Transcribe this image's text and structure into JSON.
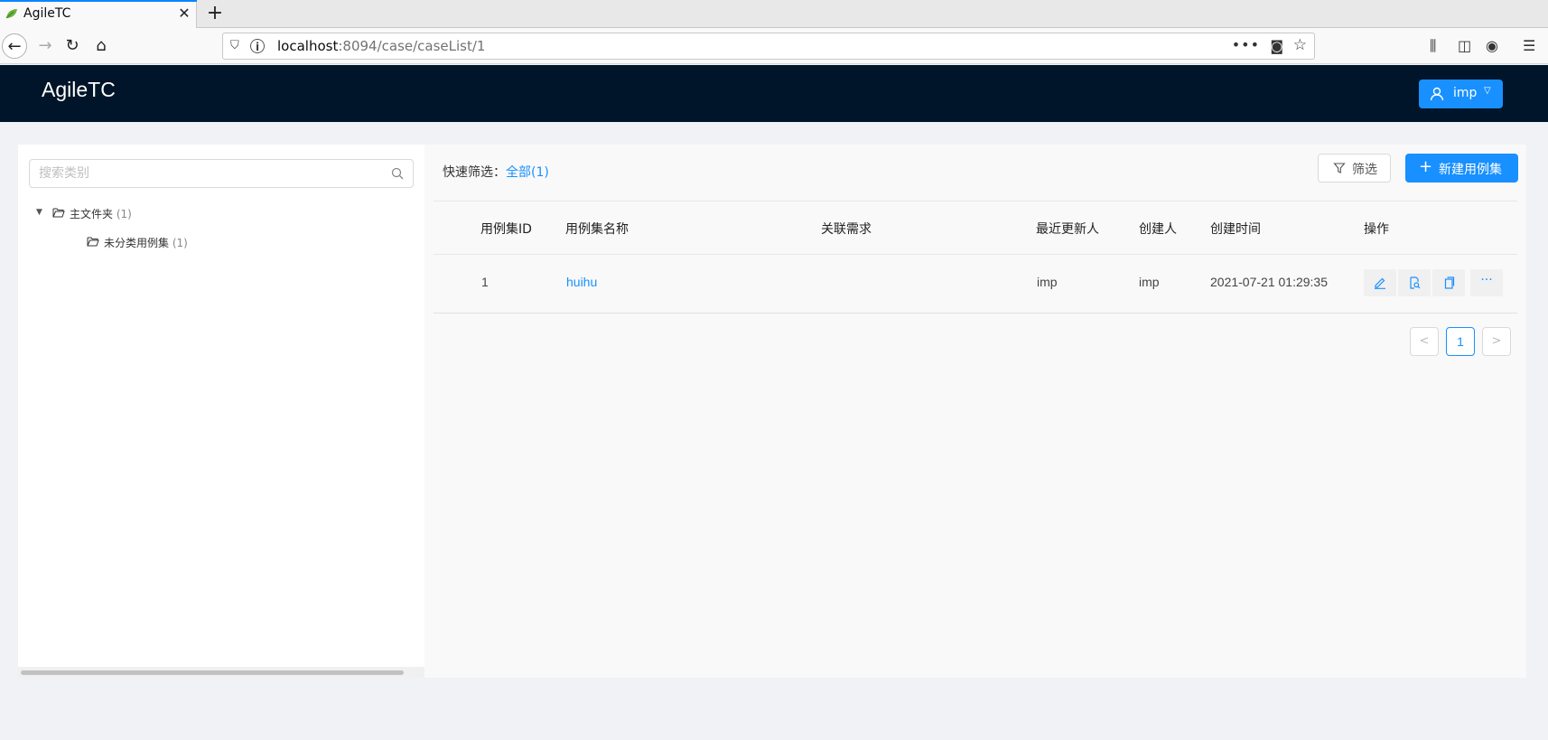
{
  "browser": {
    "tab_title": "AgileTC",
    "url_host": "localhost",
    "url_rest": ":8094/case/caseList/1",
    "icons": [
      "back-icon",
      "forward-icon",
      "reload-icon",
      "home-icon",
      "shield-icon",
      "info-icon",
      "more-icon",
      "pocket-icon",
      "star-icon",
      "library-icon",
      "sidebar-icon",
      "account-icon",
      "menu-icon"
    ]
  },
  "header": {
    "logo": "AgileTC",
    "user_name": "imp",
    "bg_color": "#001529",
    "accent_color": "#1890ff"
  },
  "sidebar": {
    "search_placeholder": "搜索类别",
    "tree": [
      {
        "label": "主文件夹",
        "count": "(1)"
      },
      {
        "label": "未分类用例集",
        "count": "(1)"
      }
    ]
  },
  "main": {
    "quick_filter_label": "快速筛选：",
    "quick_filter_value": "全部(1)",
    "filter_button": "筛选",
    "create_button": "新建用例集",
    "columns": [
      "用例集ID",
      "用例集名称",
      "关联需求",
      "最近更新人",
      "创建人",
      "创建时间",
      "操作"
    ],
    "rows": [
      {
        "id": "1",
        "name": "huihu",
        "requirement": "",
        "updater": "imp",
        "creator": "imp",
        "created_at": "2021-07-21 01:29:35"
      }
    ],
    "pagination": {
      "prev": "<",
      "current": "1",
      "next": ">"
    }
  }
}
